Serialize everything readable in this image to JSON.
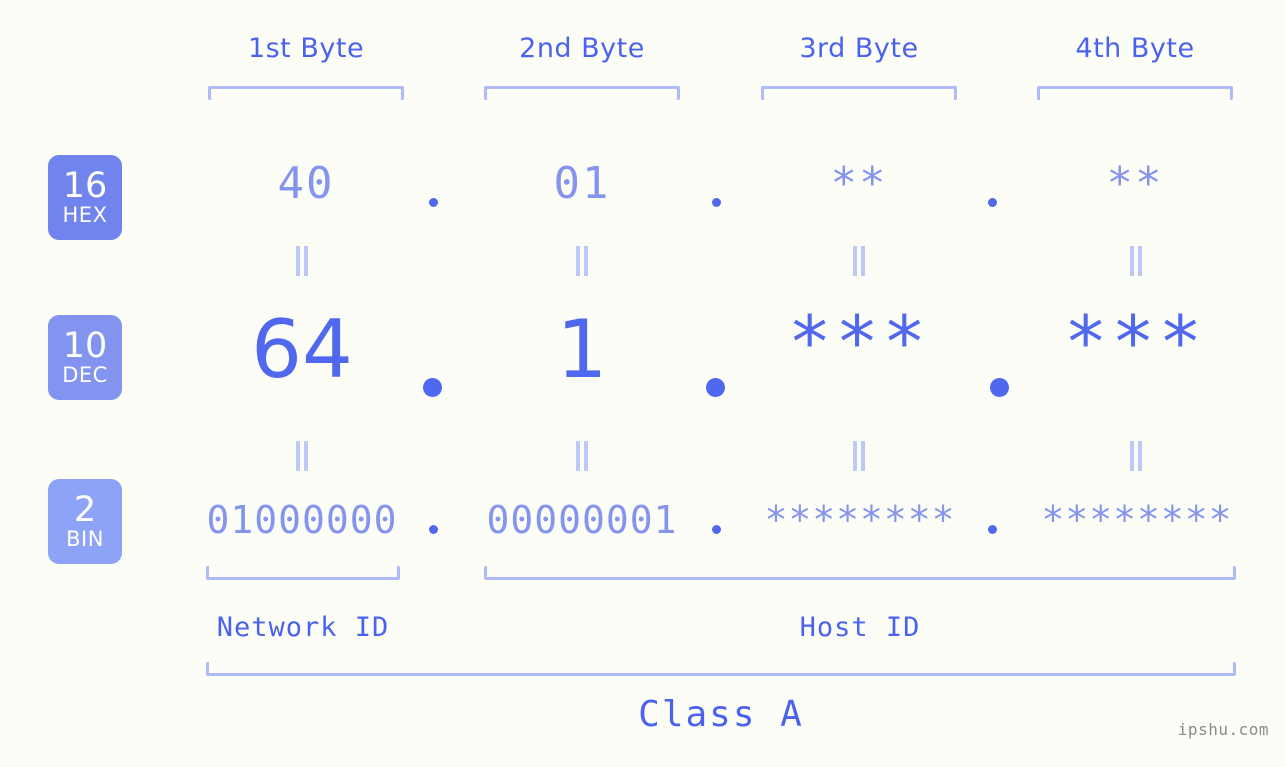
{
  "background_color": "#fdfdf8",
  "accent_colors": {
    "header_text": "#4a62ee",
    "bracket": "#aebbf7",
    "hex_value": "#8595ee",
    "dec_value": "#5068ee",
    "bin_value": "#8595ee",
    "equals_mark": "#bdc8f7",
    "badge_hex": "#7183ec",
    "badge_dec": "#8294f0",
    "badge_bin": "#8da3f7",
    "watermark": "#8a8a8a"
  },
  "byte_headers": [
    {
      "label": "1st Byte"
    },
    {
      "label": "2nd Byte"
    },
    {
      "label": "3rd Byte"
    },
    {
      "label": "4th Byte"
    }
  ],
  "rows": [
    {
      "id": "hex",
      "badge_number": "16",
      "badge_word": "HEX",
      "values": [
        "40",
        "01",
        "**",
        "**"
      ],
      "separator": "."
    },
    {
      "id": "dec",
      "badge_number": "10",
      "badge_word": "DEC",
      "values": [
        "64",
        "1",
        "***",
        "***"
      ],
      "separator": "."
    },
    {
      "id": "bin",
      "badge_number": "2",
      "badge_word": "BIN",
      "values": [
        "01000000",
        "00000001",
        "********",
        "********"
      ],
      "separator": "."
    }
  ],
  "equals_marks": {
    "glyph": "||",
    "count_per_gap": 4
  },
  "sections": [
    {
      "id": "network-id",
      "label": "Network ID"
    },
    {
      "id": "host-id",
      "label": "Host ID"
    }
  ],
  "class_label": "Class A",
  "watermark": "ipshu.com"
}
